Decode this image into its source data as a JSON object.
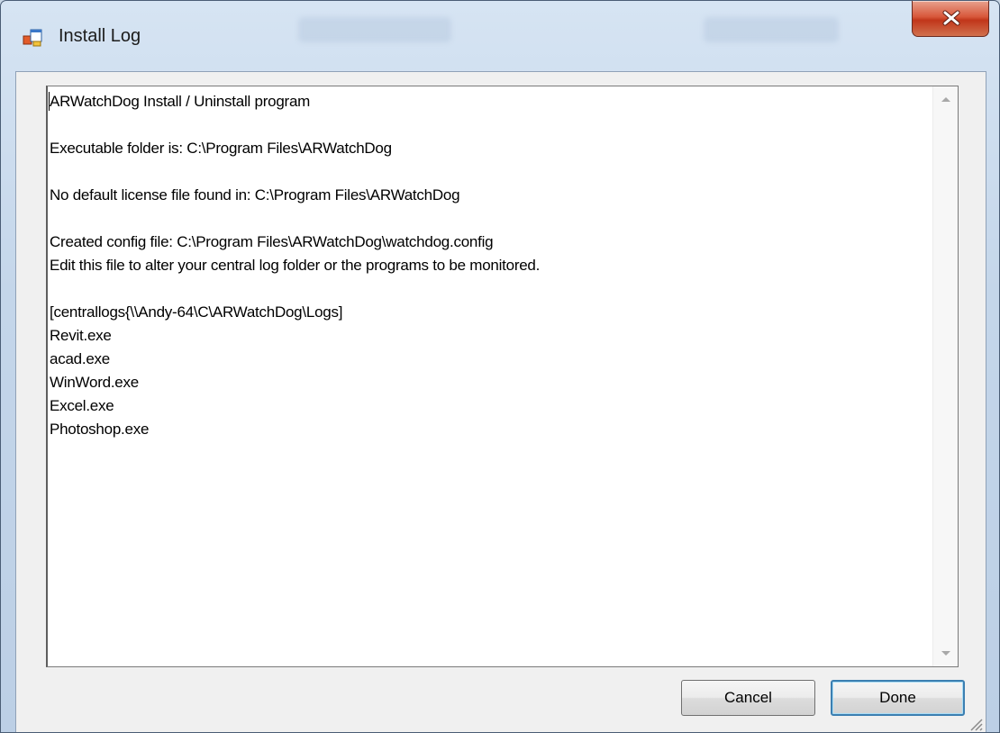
{
  "window": {
    "title": "Install Log",
    "icons": {
      "app": "app-window-icon",
      "close": "close-icon"
    }
  },
  "log": {
    "lines": [
      "ARWatchDog Install / Uninstall program",
      "",
      "Executable folder is: C:\\Program Files\\ARWatchDog",
      "",
      "No default license file found in: C:\\Program Files\\ARWatchDog",
      "",
      "Created config file: C:\\Program Files\\ARWatchDog\\watchdog.config",
      "Edit this file to alter your central log folder or the programs to be monitored.",
      "",
      "[centrallogs{\\\\Andy-64\\C\\ARWatchDog\\Logs]",
      "Revit.exe",
      "acad.exe",
      "WinWord.exe",
      "Excel.exe",
      "Photoshop.exe"
    ]
  },
  "buttons": {
    "cancel_label": "Cancel",
    "done_label": "Done"
  },
  "colors": {
    "close_button": "#c1361a",
    "default_button_border": "#3c7fb1",
    "text_area_bg": "#ffffff"
  }
}
